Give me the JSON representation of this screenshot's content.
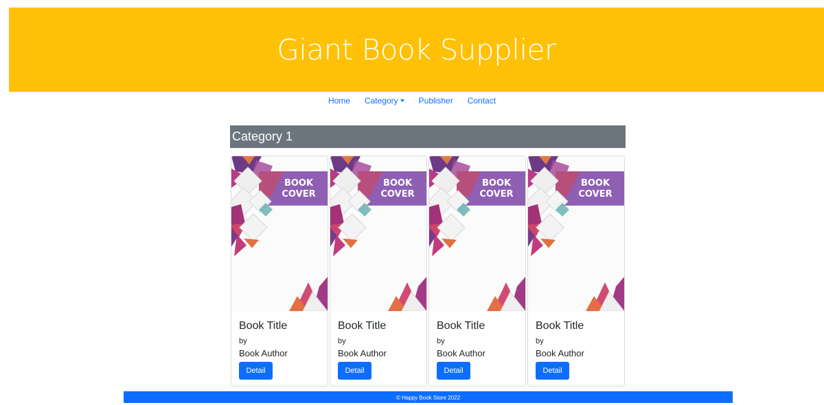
{
  "header": {
    "title": "Giant Book Supplier"
  },
  "nav": {
    "items": [
      {
        "label": "Home"
      },
      {
        "label": "Category"
      },
      {
        "label": "Publisher"
      },
      {
        "label": "Contact"
      }
    ]
  },
  "category": {
    "title": "Category 1"
  },
  "books": [
    {
      "cover_text_1": "BOOK",
      "cover_text_2": "COVER",
      "title": "Book Title",
      "by": "by",
      "author": "Book Author",
      "button": "Detail"
    },
    {
      "cover_text_1": "BOOK",
      "cover_text_2": "COVER",
      "title": "Book Title",
      "by": "by",
      "author": "Book Author",
      "button": "Detail"
    },
    {
      "cover_text_1": "BOOK",
      "cover_text_2": "COVER",
      "title": "Book Title",
      "by": "by",
      "author": "Book Author",
      "button": "Detail"
    },
    {
      "cover_text_1": "BOOK",
      "cover_text_2": "COVER",
      "title": "Book Title",
      "by": "by",
      "author": "Book Author",
      "button": "Detail"
    }
  ],
  "footer": {
    "text": "© Happy Book Store 2022"
  },
  "colors": {
    "header_bg": "#ffc107",
    "link": "#0d6efd",
    "category_bg": "#6c757d",
    "button_bg": "#0d6efd",
    "footer_bg": "#0d6efd",
    "cover_banner": "#8e5fb3"
  }
}
